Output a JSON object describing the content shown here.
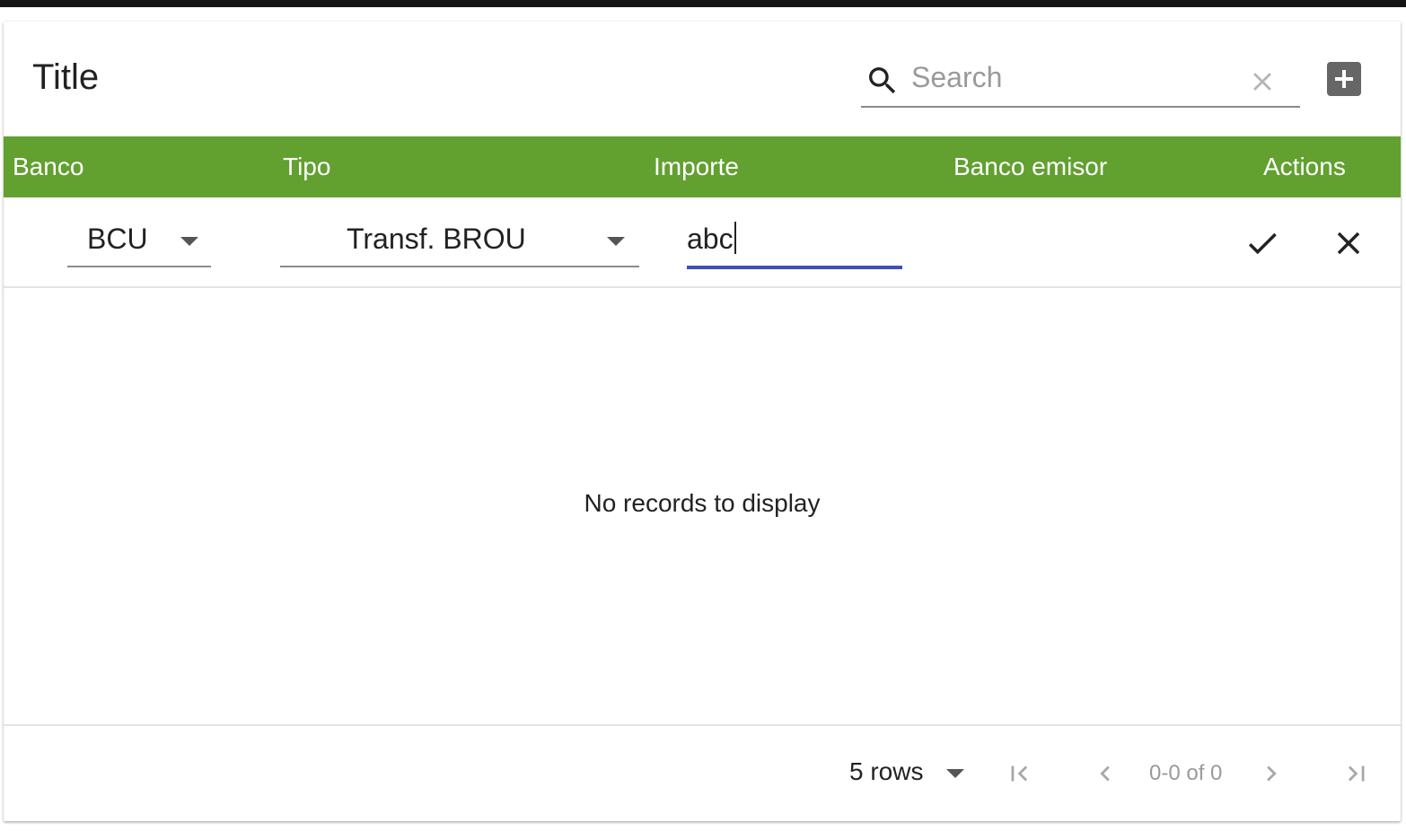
{
  "table": {
    "title": "Title",
    "search": {
      "placeholder": "Search",
      "value": ""
    },
    "icons": {
      "search": "search-icon",
      "clear": "close-icon",
      "add": "add-box-icon",
      "save": "check-icon",
      "cancel": "close-icon",
      "first_page": "first-page-icon",
      "previous_page": "chevron-left-icon",
      "next_page": "chevron-right-icon",
      "last_page": "last-page-icon",
      "dropdown": "arrow-drop-down-icon"
    },
    "columns": [
      "Banco",
      "Tipo",
      "Importe",
      "Banco emisor",
      "Actions"
    ],
    "edit_row": {
      "banco": "BCU",
      "tipo": "Transf. BROU",
      "importe": "abc"
    },
    "empty_message": "No records to display",
    "pagination": {
      "rows_per_page": "5 rows",
      "range": "0-0 of 0"
    },
    "colors": {
      "header_bg": "#62a030",
      "header_text": "#ffffff",
      "focus_underline": "#3f51b5",
      "add_button": "#666666"
    }
  }
}
